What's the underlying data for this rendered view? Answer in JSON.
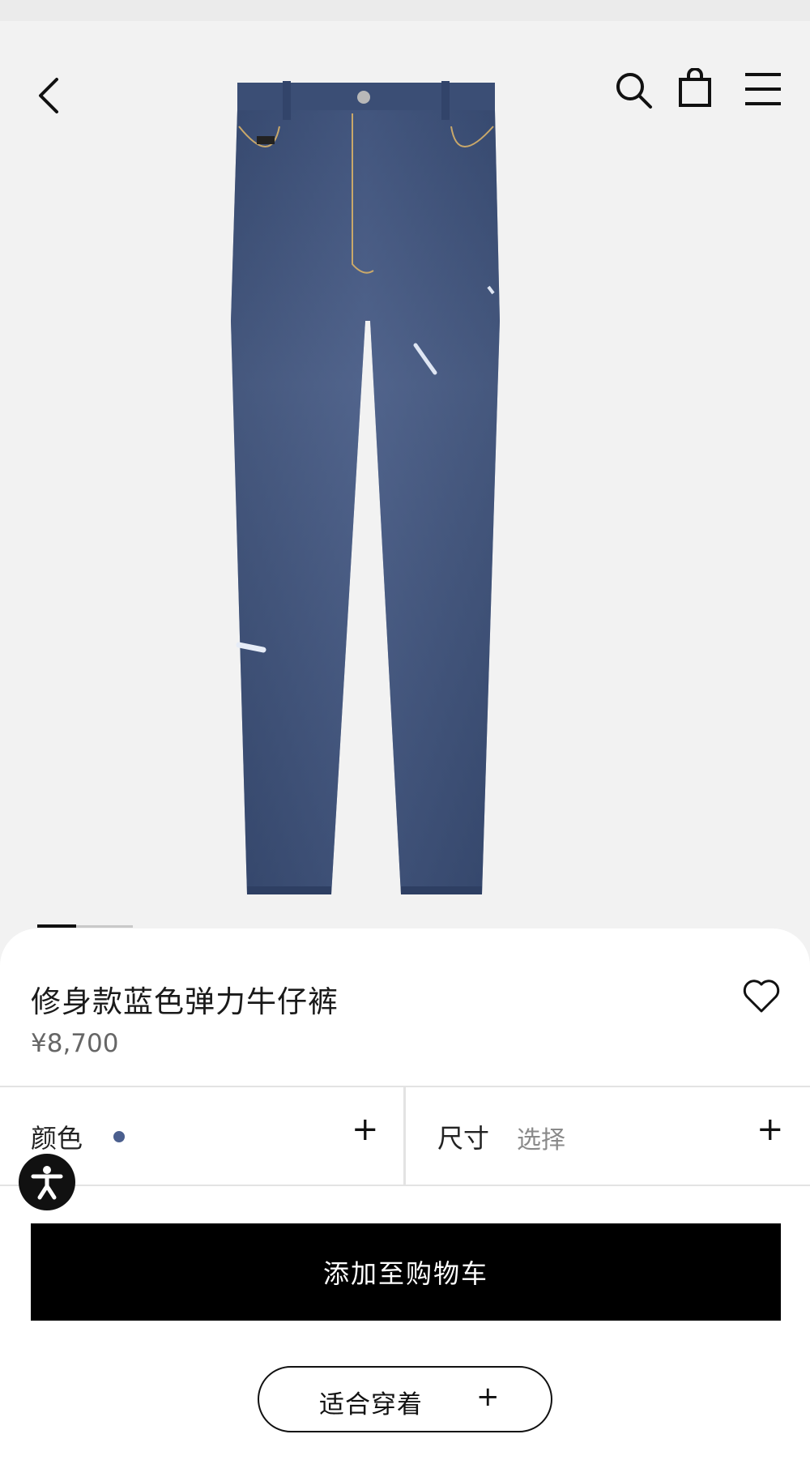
{
  "product": {
    "title": "修身款蓝色弹力牛仔裤",
    "price": "¥8,700",
    "image_alt": "blue stretch jeans product image"
  },
  "options": {
    "color_label": "颜色",
    "color_swatch": "#4b5f8e",
    "size_label": "尺寸",
    "size_value": "选择",
    "plus": "+"
  },
  "actions": {
    "add_to_cart": "添加至购物车",
    "fit_label": "适合穿着",
    "fit_plus": "+"
  },
  "gallery": {
    "current_index": 1,
    "total": 2
  },
  "colors": {
    "primary": "#000000",
    "background": "#f2f2f2",
    "sheet": "#ffffff",
    "denim": "#3c4f74"
  },
  "icons": [
    "chevron-left-icon",
    "search-icon",
    "shopping-bag-icon",
    "menu-icon",
    "heart-icon",
    "accessibility-icon"
  ]
}
